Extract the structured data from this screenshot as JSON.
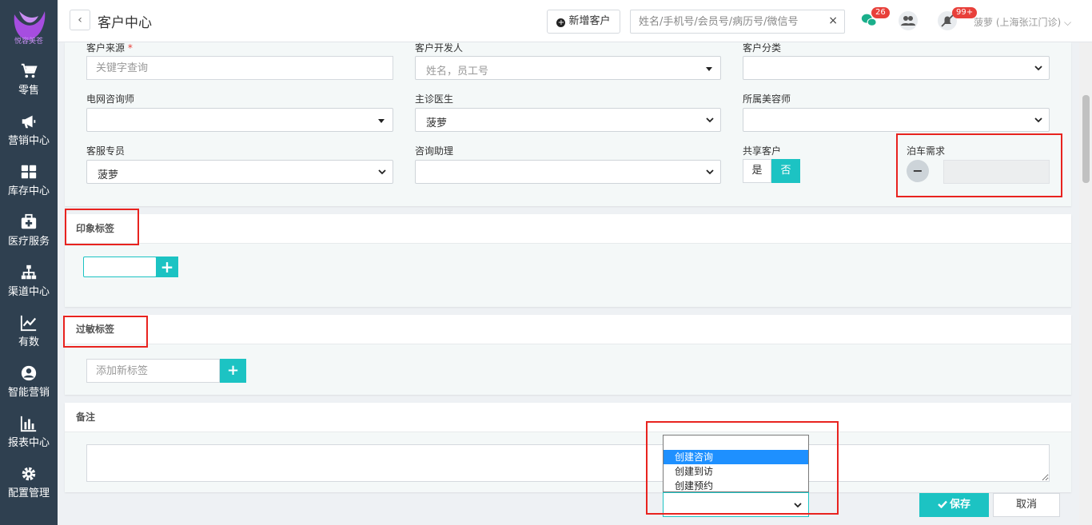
{
  "sidebar": {
    "logo_text": "悦容美苍",
    "items": [
      {
        "label": "零售",
        "icon": "cart-icon"
      },
      {
        "label": "营销中心",
        "icon": "megaphone-icon"
      },
      {
        "label": "库存中心",
        "icon": "grid-icon"
      },
      {
        "label": "医疗服务",
        "icon": "medkit-icon"
      },
      {
        "label": "渠道中心",
        "icon": "sitemap-icon"
      },
      {
        "label": "有数",
        "icon": "line-chart-icon"
      },
      {
        "label": "智能营销",
        "icon": "user-circle-icon"
      },
      {
        "label": "报表中心",
        "icon": "bar-chart-icon"
      },
      {
        "label": "配置管理",
        "icon": "gear-icon"
      }
    ]
  },
  "header": {
    "back": "‹",
    "title": "客户中心",
    "new_customer": "新增客户",
    "search_placeholder": "姓名/手机号/会员号/病历号/微信号",
    "search_clear": "×",
    "wechat_badge": "26",
    "notify_badge": "99+",
    "user": "菠萝 (上海张江门诊) ⌵"
  },
  "form": {
    "source_label": "客户来源",
    "source_required": "*",
    "source_placeholder": "关键字查询",
    "developer_label": "客户开发人",
    "developer_placeholder": "姓名，员工号",
    "category_label": "客户分类",
    "online_consultant_label": "电网咨询师",
    "doctor_label": "主诊医生",
    "doctor_value": "菠萝",
    "beautician_label": "所属美容师",
    "service_label": "客服专员",
    "service_value": "菠萝",
    "assistant_label": "咨询助理",
    "shared_label": "共享客户",
    "shared_yes": "是",
    "shared_no": "否",
    "parking_label": "泊车需求",
    "parking_toggle": "−"
  },
  "impression": {
    "title": "印象标签",
    "add": "+"
  },
  "allergy": {
    "title": "过敏标签",
    "placeholder": "添加新标签",
    "add": "+"
  },
  "remark": {
    "title": "备注"
  },
  "dropdown": {
    "options": [
      "",
      "创建咨询",
      "创建到访",
      "创建预约"
    ],
    "selected": "创建咨询"
  },
  "actions": {
    "save": "保存",
    "cancel": "取消"
  },
  "colors": {
    "accent": "#1cc3c3",
    "sidebar": "#2f4050",
    "badge": "#e8403a",
    "highlight": "#e8231f"
  }
}
